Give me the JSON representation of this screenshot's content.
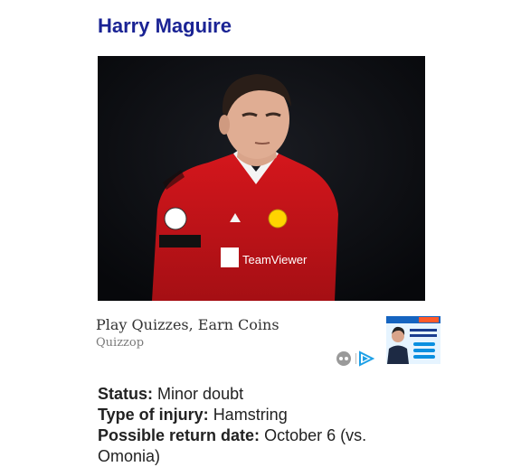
{
  "player": {
    "name": "Harry Maguire"
  },
  "photo": {
    "sponsor_text": "TeamViewer"
  },
  "ad": {
    "headline": "Play Quizzes, Earn Coins",
    "source": "Quizzop",
    "icons": [
      "adchoices-icon",
      "play-triangle-icon"
    ]
  },
  "injury": {
    "status_label": "Status:",
    "status_value": "Minor doubt",
    "type_label": "Type of injury:",
    "type_value": "Hamstring",
    "return_label": "Possible return date:",
    "return_value": "October 6 (vs. Omonia)"
  },
  "colors": {
    "title": "#1a2394",
    "kit_red": "#c7141b",
    "ad_accent": "#0a8fe0"
  }
}
